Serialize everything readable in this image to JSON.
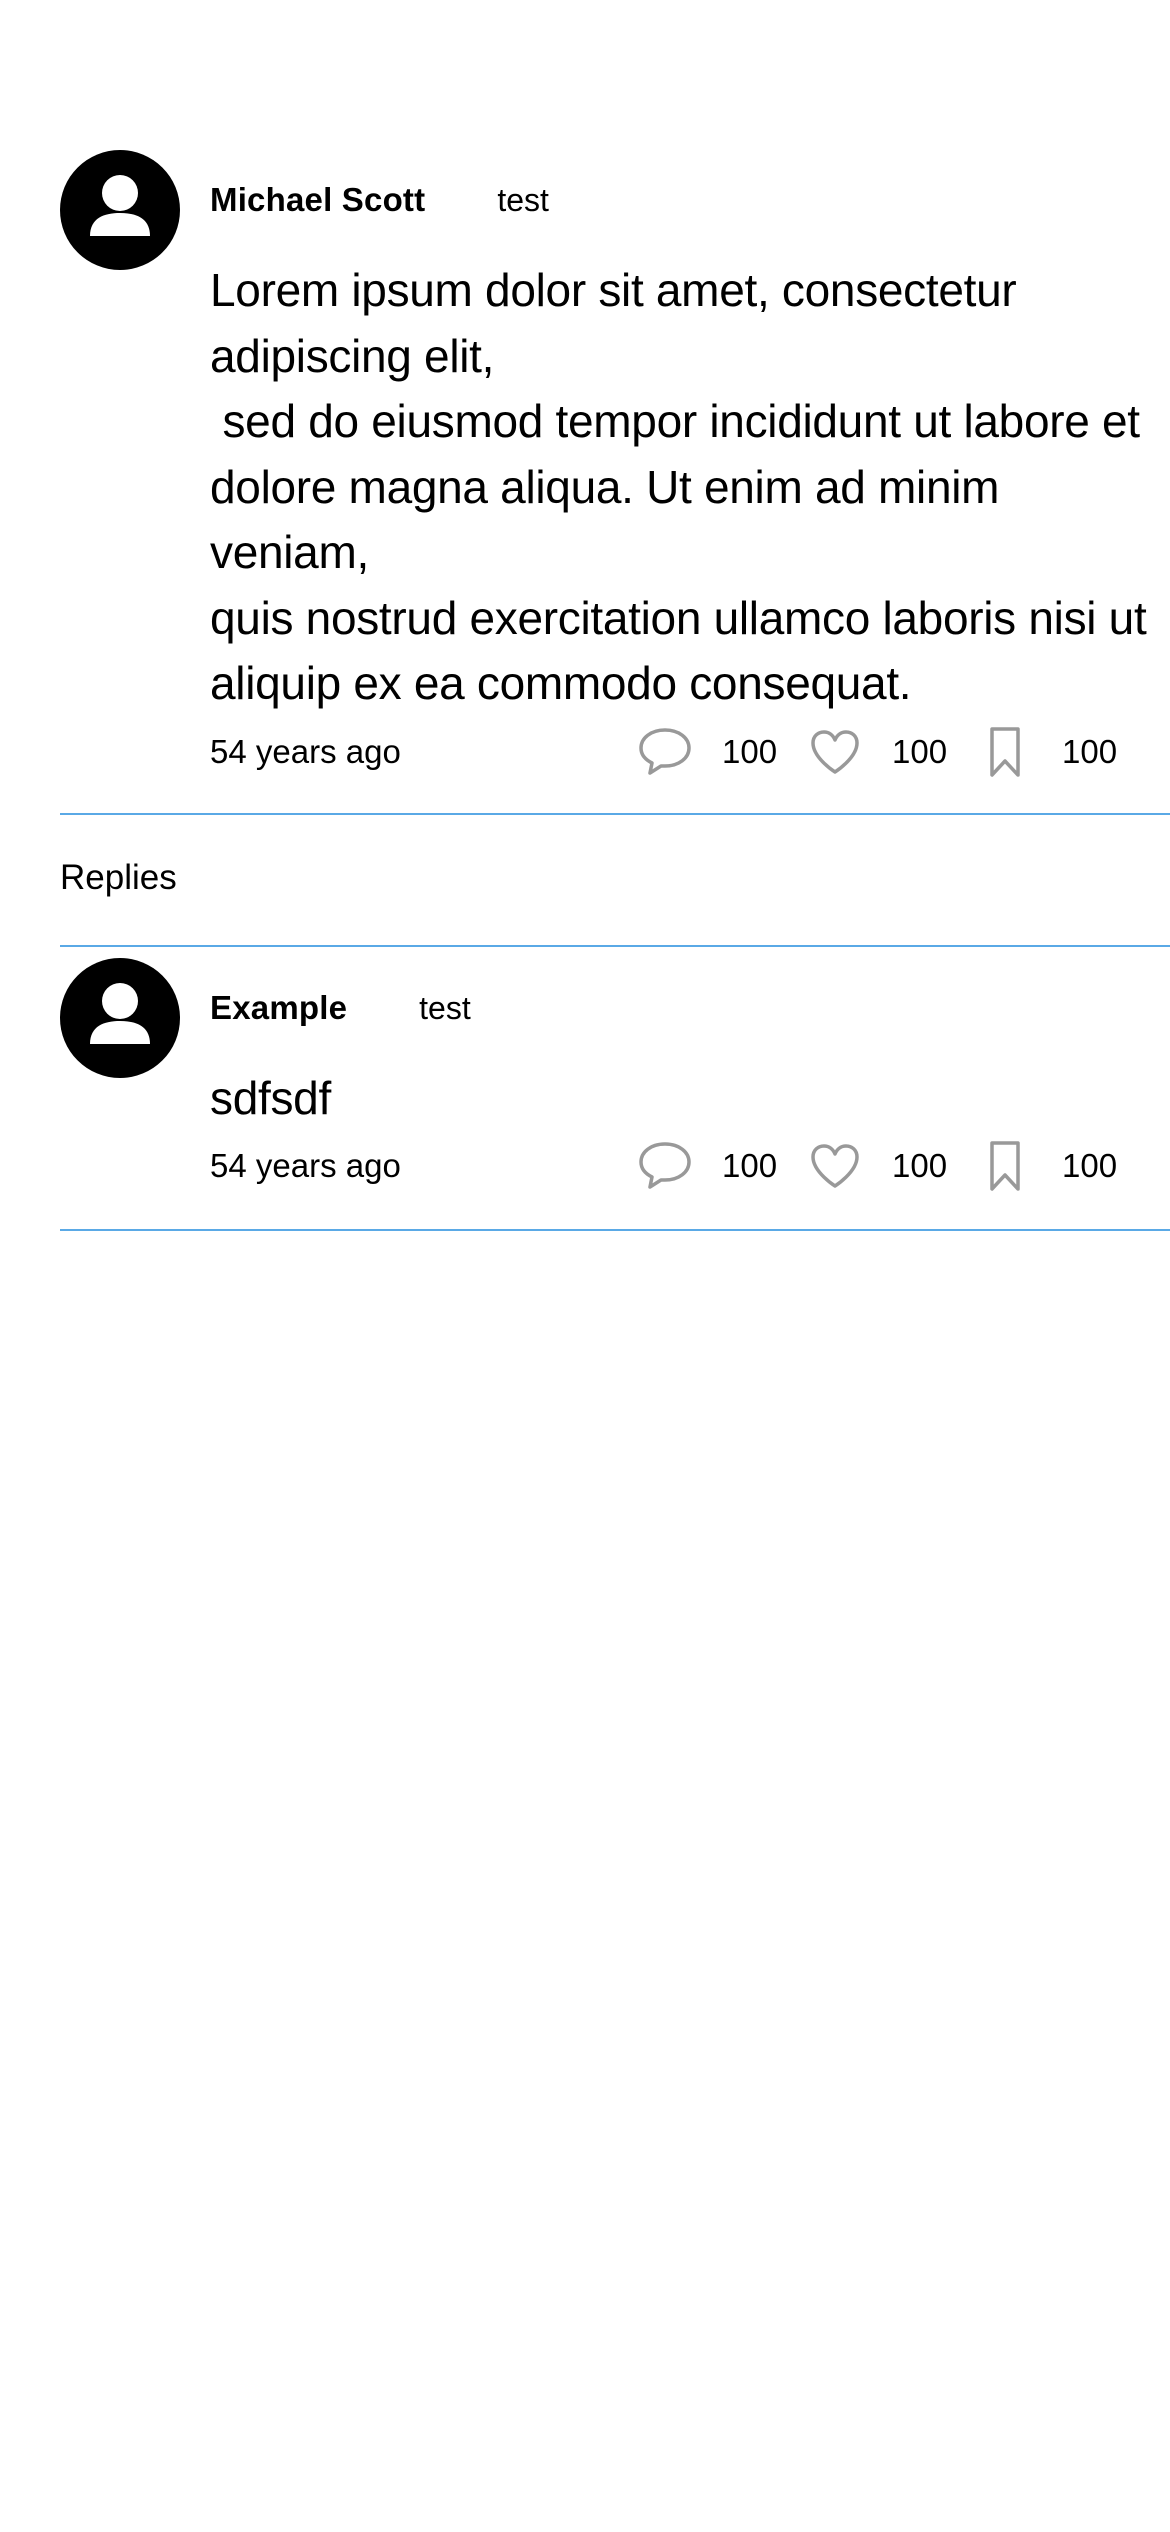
{
  "post": {
    "author_name": "Michael Scott",
    "author_handle": "test",
    "body": "Lorem ipsum dolor sit amet, consectetur adipiscing elit,\n sed do eiusmod tempor incididunt ut labore et dolore magna aliqua. Ut enim ad minim veniam,\nquis nostrud exercitation ullamco laboris nisi ut aliquip ex ea commodo consequat.",
    "timestamp": "54 years ago",
    "comment_count": "100",
    "like_count": "100",
    "bookmark_count": "100"
  },
  "replies_label": "Replies",
  "replies": [
    {
      "author_name": "Example",
      "author_handle": "test",
      "body": "sdfsdf",
      "timestamp": "54 years ago",
      "comment_count": "100",
      "like_count": "100",
      "bookmark_count": "100"
    }
  ],
  "icons": {
    "avatar": "user-avatar-icon",
    "comment": "speech-bubble-icon",
    "like": "heart-icon",
    "bookmark": "bookmark-icon"
  },
  "colors": {
    "divider": "#5aa9e6",
    "icon_stroke": "#999999",
    "avatar_bg": "#000000"
  }
}
